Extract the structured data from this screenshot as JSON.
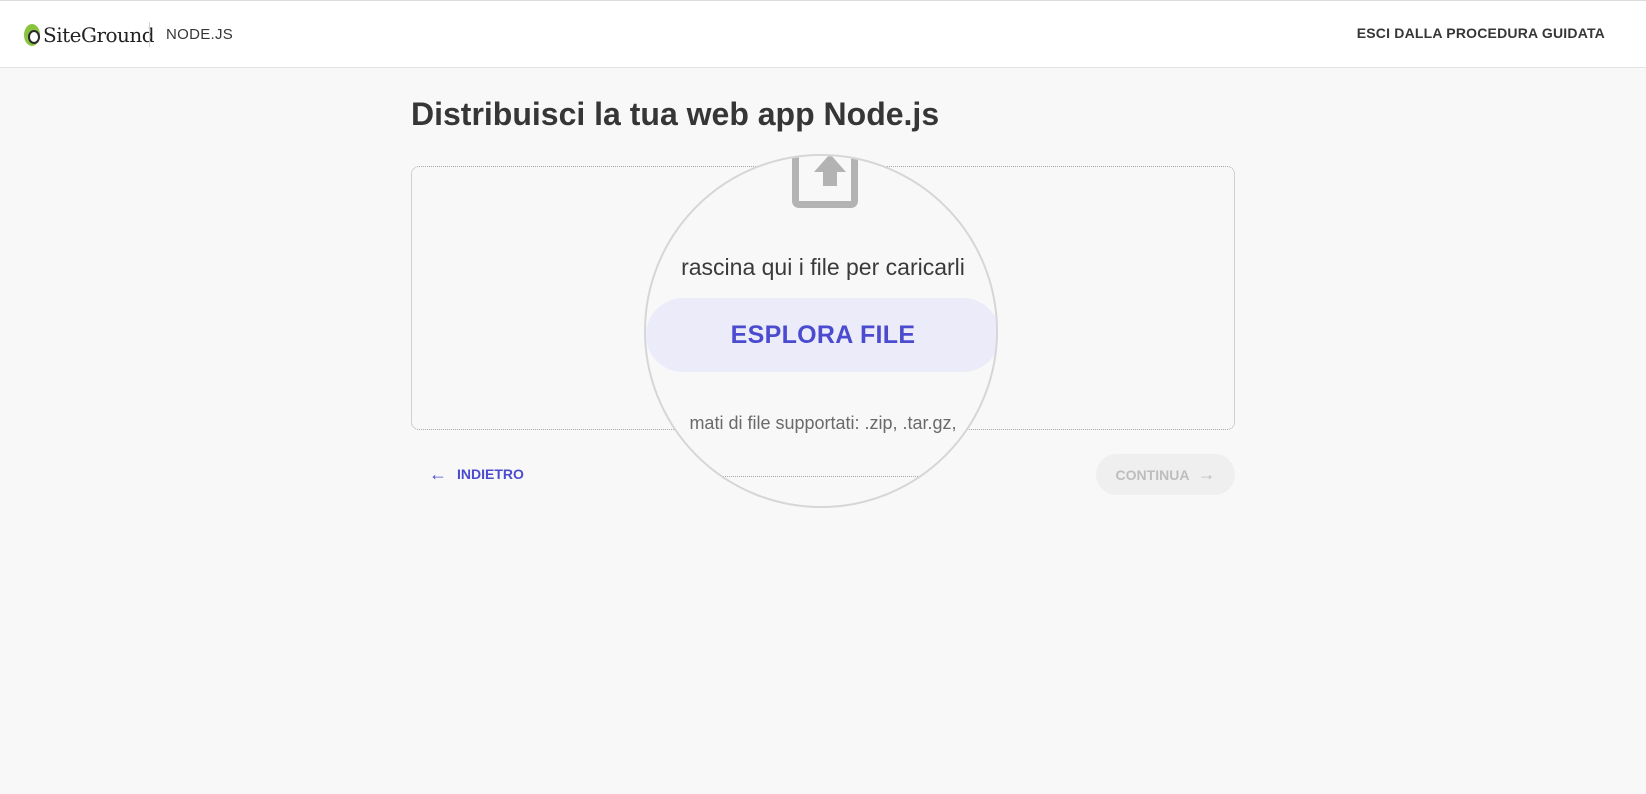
{
  "header": {
    "brand": "SiteGround",
    "section": "NODE.JS",
    "exit_label": "ESCI DALLA PROCEDURA GUIDATA"
  },
  "main": {
    "title": "Distribuisci la tua web app Node.js",
    "upload": {
      "icon": "upload-icon",
      "drop_text": "rascina qui i file per caricarli",
      "browse_label": "ESPLORA FILE",
      "formats_text": "mati di file supportati: .zip, .tar.gz,"
    }
  },
  "footer_nav": {
    "back_label": "INDIETRO",
    "back_icon": "arrow-left-icon",
    "continue_label": "CONTINUA",
    "continue_icon": "arrow-right-icon",
    "continue_disabled": true
  },
  "colors": {
    "accent": "#4b4bcf",
    "accent_light": "#ebebfa",
    "brand_green": "#8ac43f",
    "background": "#f8f8f8"
  }
}
